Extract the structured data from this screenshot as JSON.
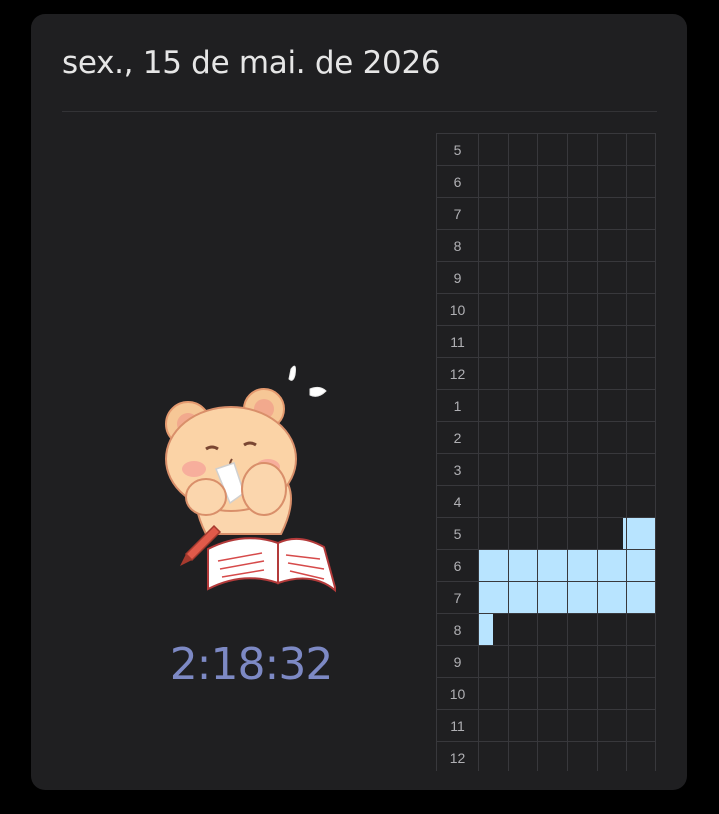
{
  "header": {
    "date": "sex., 15 de mai. de 2026"
  },
  "timer": {
    "elapsed": "2:18:32"
  },
  "colors": {
    "background": "#1f1f21",
    "accent": "#7d89c4",
    "fill": "#b8e4ff"
  },
  "mascot": {
    "icon": "bear-crying-studying-icon"
  },
  "schedule": {
    "columns": 6,
    "hours": [
      {
        "label": "5",
        "fills": [
          0,
          0,
          0,
          0,
          0,
          0.0
        ]
      },
      {
        "label": "6",
        "fills": [
          0,
          0,
          0,
          0,
          0,
          0
        ]
      },
      {
        "label": "7",
        "fills": [
          0,
          0,
          0,
          0,
          0,
          0
        ]
      },
      {
        "label": "8",
        "fills": [
          0,
          0,
          0,
          0,
          0,
          0
        ]
      },
      {
        "label": "9",
        "fills": [
          0,
          0,
          0,
          0,
          0,
          0
        ]
      },
      {
        "label": "10",
        "fills": [
          0,
          0,
          0,
          0,
          0,
          0
        ]
      },
      {
        "label": "11",
        "fills": [
          0,
          0,
          0,
          0,
          0,
          0
        ]
      },
      {
        "label": "12",
        "fills": [
          0,
          0,
          0,
          0,
          0,
          0
        ]
      },
      {
        "label": "1",
        "fills": [
          0,
          0,
          0,
          0,
          0,
          0
        ]
      },
      {
        "label": "2",
        "fills": [
          0,
          0,
          0,
          0,
          0,
          0
        ]
      },
      {
        "label": "3",
        "fills": [
          0,
          0,
          0,
          0,
          0,
          0
        ]
      },
      {
        "label": "4",
        "fills": [
          0,
          0,
          0,
          0,
          0,
          0
        ]
      },
      {
        "label": "5",
        "fills": [
          0,
          0,
          0,
          0,
          0.1,
          1
        ]
      },
      {
        "label": "6",
        "fills": [
          1,
          1,
          1,
          1,
          1,
          1
        ]
      },
      {
        "label": "7",
        "fills": [
          1,
          1,
          1,
          1,
          1,
          1
        ]
      },
      {
        "label": "8",
        "fills": [
          0.5,
          0,
          0,
          0,
          0,
          0
        ]
      },
      {
        "label": "9",
        "fills": [
          0,
          0,
          0,
          0,
          0,
          0
        ]
      },
      {
        "label": "10",
        "fills": [
          0,
          0,
          0,
          0,
          0,
          0
        ]
      },
      {
        "label": "11",
        "fills": [
          0,
          0,
          0,
          0,
          0,
          0
        ]
      },
      {
        "label": "12",
        "fills": [
          0,
          0,
          0,
          0,
          0,
          0
        ]
      }
    ]
  }
}
